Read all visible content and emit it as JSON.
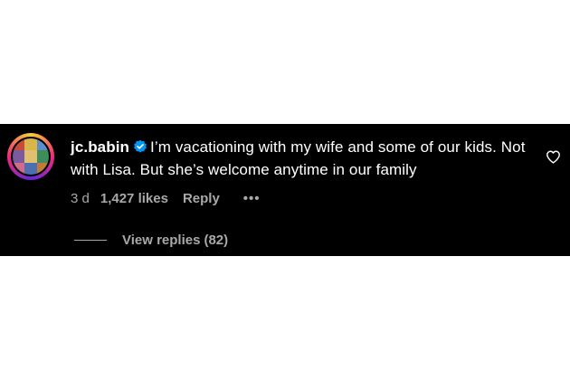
{
  "comment": {
    "username": "jc.babin",
    "text": "I’m vacationing with my wife and some of our kids. Not with Lisa. But she’s welcome anytime in our family",
    "time": "3 d",
    "likes": "1,427 likes",
    "reply_label": "Reply",
    "more_label": "•••",
    "view_replies_label": "View replies",
    "reply_count": "(82)"
  },
  "colors": {
    "panel_bg": "#000000",
    "text": "#ffffff",
    "muted": "#a8a8a8",
    "verified": "#0095f6"
  },
  "icons": {
    "verified": "verified-badge-icon",
    "heart": "heart-outline-icon"
  }
}
